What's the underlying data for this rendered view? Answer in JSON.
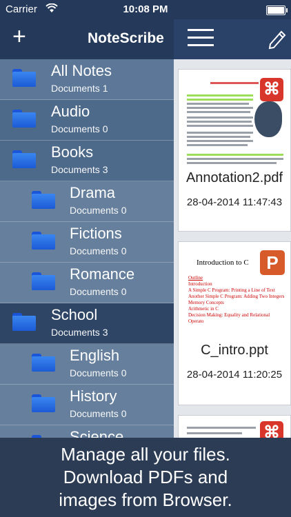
{
  "status_bar": {
    "carrier": "Carrier",
    "time": "10:08 PM"
  },
  "header": {
    "add_label": "+",
    "title": "NoteScribe"
  },
  "folders": [
    {
      "name": "All Notes",
      "count_text": "Documents 1"
    },
    {
      "name": "Audio",
      "count_text": "Documents 0"
    },
    {
      "name": "Books",
      "count_text": "Documents 3"
    },
    {
      "name": "Drama",
      "count_text": "Documents 0"
    },
    {
      "name": "Fictions",
      "count_text": "Documents 0"
    },
    {
      "name": "Romance",
      "count_text": "Documents 0"
    },
    {
      "name": "School",
      "count_text": "Documents 3"
    },
    {
      "name": "English",
      "count_text": "Documents 0"
    },
    {
      "name": "History",
      "count_text": "Documents 0"
    },
    {
      "name": "Science",
      "count_text": ""
    }
  ],
  "documents": [
    {
      "name": "Annotation2.pdf",
      "date": "28-04-2014 11:47:43",
      "badge": "⌘"
    },
    {
      "name": "C_intro.ppt",
      "date": "28-04-2014 11:20:25",
      "badge": "P",
      "slide_title": "Introduction to C",
      "slide_lines": [
        "Outline",
        "Introduction",
        "A Simple C Program: Printing a Line of Text",
        "Another Simple C Program: Adding Two Integers",
        "Memory Concepts",
        "Arithmetic in C",
        "Decision Making: Equality and Relational Operato"
      ]
    },
    {
      "name": "",
      "date": ""
    }
  ],
  "footer": {
    "line1": "Manage all your files.",
    "line2": "Download PDFs and",
    "line3": "images from Browser."
  }
}
